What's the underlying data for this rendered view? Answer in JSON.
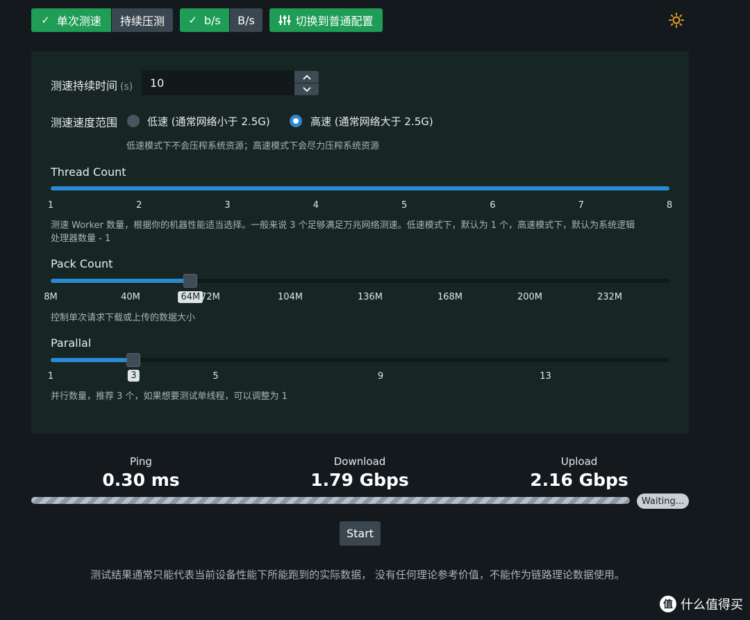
{
  "toolbar": {
    "single_test": "单次测速",
    "continuous_test": "持续压测",
    "bits": "b/s",
    "bytes": "B/s",
    "switch_config": "切换到普通配置"
  },
  "duration": {
    "label": "测速持续时间",
    "unit": "(s)",
    "value": "10"
  },
  "speed_range": {
    "label": "测速速度范围",
    "low_label": "低速 (通常网络小于 2.5G)",
    "high_label": "高速 (通常网络大于 2.5G)",
    "selected": "high",
    "help": "低速模式下不会压榨系统资源；高速模式下会尽力压榨系统资源"
  },
  "thread_count": {
    "label": "Thread Count",
    "ticks": [
      "1",
      "2",
      "3",
      "4",
      "5",
      "6",
      "7",
      "8"
    ],
    "value": 8,
    "help_line1": "测速 Worker 数量，根据你的机器性能适当选择。一般来说 3 个足够满足万兆网络测速。低速模式下，默认为 1 个，高速模式下，默认为系统逻辑",
    "help_line2": "处理器数量 - 1"
  },
  "pack_count": {
    "label": "Pack Count",
    "ticks": [
      "8M",
      "40M",
      "72M",
      "104M",
      "136M",
      "168M",
      "200M",
      "232M"
    ],
    "value_label": "64M",
    "fraction": 0.226,
    "help": "控制单次请求下载或上传的数据大小"
  },
  "parallel": {
    "label": "Parallal",
    "ticks": [
      "1",
      "5",
      "9",
      "13"
    ],
    "value_label": "3",
    "fraction": 0.134,
    "help": "并行数量，推荐 3 个，如果想要测试单线程，可以调整为 1"
  },
  "results": {
    "ping_label": "Ping",
    "ping_value": "0.30 ms",
    "download_label": "Download",
    "download_value": "1.79 Gbps",
    "upload_label": "Upload",
    "upload_value": "2.16 Gbps",
    "status": "Waiting..."
  },
  "start_label": "Start",
  "footer": "测试结果通常只能代表当前设备性能下所能跑到的实际数据， 没有任何理论参考价值，不能作为链路理论数据使用。",
  "watermark": {
    "logo": "值",
    "text": "什么值得买"
  },
  "colors": {
    "accent_green": "#1f9d57",
    "accent_blue": "#2a8ad6",
    "theme_icon": "#f0a020"
  }
}
